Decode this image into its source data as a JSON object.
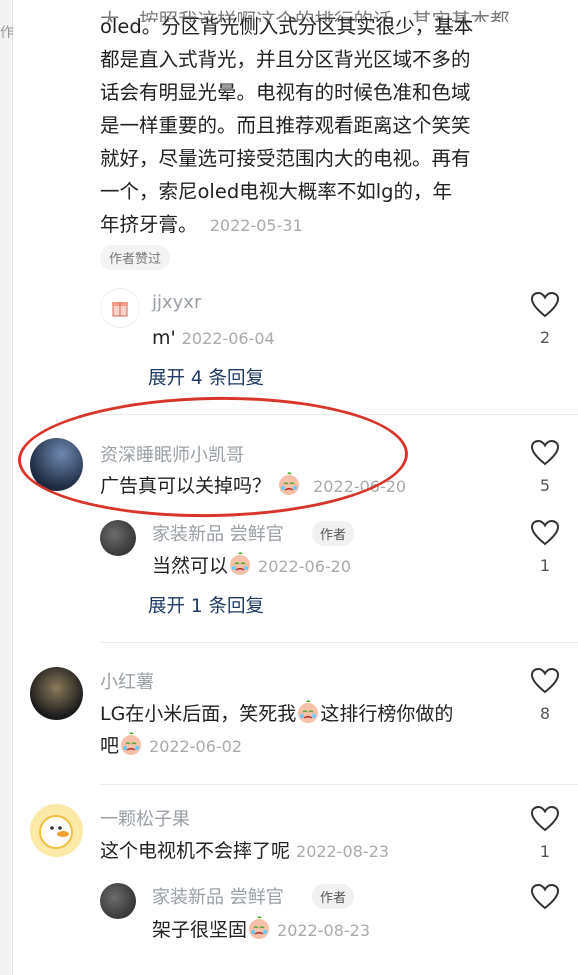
{
  "top_comment": {
    "clipped_line": "大，按照我这样啊这个的排行的话，其实基本都是",
    "lines": [
      "oled。分区背光侧入式分区其实很少，基本",
      "都是直入式背光，并且分区背光区域不多的",
      "话会有明显光晕。电视有的时候色准和色域",
      "是一样重要的。而且推荐观看距离这个笑笑",
      "就好，尽量选可接受范围内大的电视。再有",
      "一个，索尼oled电视大概率不如lg的，年"
    ],
    "last_line": "年挤牙膏。",
    "time": "2022-05-31",
    "tag": "作者赞过"
  },
  "replies": [
    {
      "user": "jjxyxr",
      "text": "m'",
      "time": "2022-06-04",
      "likes": "2"
    }
  ],
  "expand1": "展开 4 条回复",
  "comment2": {
    "user": "资深睡眠师小凯哥",
    "text": "广告真可以关掉吗？",
    "time": "2022-06-20",
    "likes": "5",
    "reply": {
      "user": "家装新品 尝鲜官",
      "badge": "作者",
      "text": "当然可以",
      "time": "2022-06-20",
      "likes": "1"
    }
  },
  "expand2": "展开 1 条回复",
  "comment3": {
    "user": "小红薯",
    "line1": "LG在小米后面，笑死我",
    "line1b": "这排行榜你做的",
    "line2": "吧",
    "time": "2022-06-02",
    "likes": "8"
  },
  "comment4": {
    "user": "一颗松子果",
    "text": "这个电视机不会摔了呢",
    "time": "2022-08-23",
    "likes": "1",
    "reply": {
      "user": "家装新品 尝鲜官",
      "badge": "作者",
      "text": "架子很坚固",
      "time": "2022-08-23"
    }
  },
  "left_edge_glyph": "作",
  "colors": {
    "accent_link": "#1f3a66",
    "annotation_ellipse": "#d8342a"
  }
}
